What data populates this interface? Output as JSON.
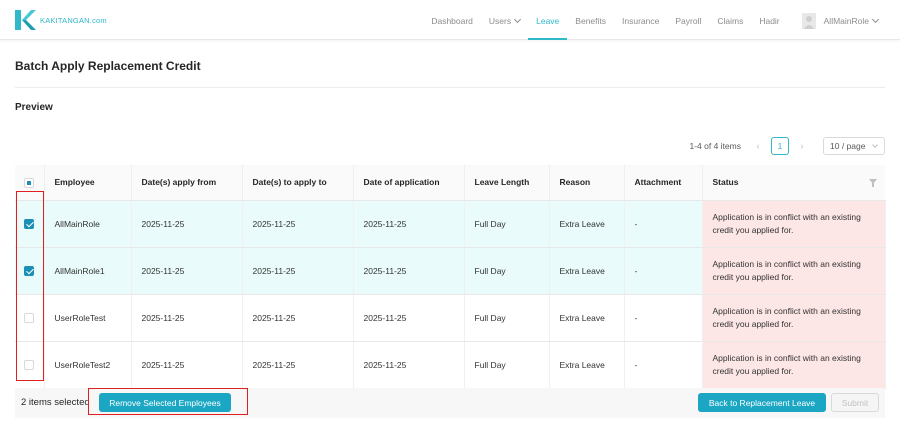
{
  "brand": {
    "name": "KAKITANGAN.com",
    "color": "#2fb9c9"
  },
  "nav": {
    "items": [
      {
        "label": "Dashboard",
        "active": false,
        "dropdown": false
      },
      {
        "label": "Users",
        "active": false,
        "dropdown": true
      },
      {
        "label": "Leave",
        "active": true,
        "dropdown": false
      },
      {
        "label": "Benefits",
        "active": false,
        "dropdown": false
      },
      {
        "label": "Insurance",
        "active": false,
        "dropdown": false
      },
      {
        "label": "Payroll",
        "active": false,
        "dropdown": false
      },
      {
        "label": "Claims",
        "active": false,
        "dropdown": false
      },
      {
        "label": "Hadir",
        "active": false,
        "dropdown": false
      }
    ],
    "user": {
      "name": "AllMainRole",
      "icon": "user-avatar-icon"
    }
  },
  "page": {
    "title": "Batch Apply Replacement Credit",
    "section_title": "Preview"
  },
  "pagination": {
    "total_text": "1-4 of 4 items",
    "current_page": "1",
    "prev_icon": "‹",
    "next_icon": "›",
    "page_size": "10 / page"
  },
  "table": {
    "columns": [
      "Employee",
      "Date(s) apply from",
      "Date(s) to apply to",
      "Date of application",
      "Leave Length",
      "Reason",
      "Attachment",
      "Status"
    ],
    "rows": [
      {
        "selected": true,
        "employee": "AllMainRole",
        "from": "2025-11-25",
        "to": "2025-11-25",
        "applied": "2025-11-25",
        "length": "Full Day",
        "reason": "Extra Leave",
        "attachment": "-",
        "status": "Application is in conflict with an existing credit you applied for."
      },
      {
        "selected": true,
        "employee": "AllMainRole1",
        "from": "2025-11-25",
        "to": "2025-11-25",
        "applied": "2025-11-25",
        "length": "Full Day",
        "reason": "Extra Leave",
        "attachment": "-",
        "status": "Application is in conflict with an existing credit you applied for."
      },
      {
        "selected": false,
        "employee": "UserRoleTest",
        "from": "2025-11-25",
        "to": "2025-11-25",
        "applied": "2025-11-25",
        "length": "Full Day",
        "reason": "Extra Leave",
        "attachment": "-",
        "status": "Application is in conflict with an existing credit you applied for."
      },
      {
        "selected": false,
        "employee": "UserRoleTest2",
        "from": "2025-11-25",
        "to": "2025-11-25",
        "applied": "2025-11-25",
        "length": "Full Day",
        "reason": "Extra Leave",
        "attachment": "-",
        "status": "Application is in conflict with an existing credit you applied for."
      }
    ]
  },
  "footer": {
    "selected_text": "2 items selected",
    "remove_label": "Remove Selected Employees",
    "back_label": "Back to Replacement Leave",
    "submit_label": "Submit"
  },
  "colors": {
    "accent": "#1ba7c3",
    "selected_row": "#e9fbfa",
    "status_error_bg": "#fde6e6",
    "annotation": "#e02020"
  }
}
